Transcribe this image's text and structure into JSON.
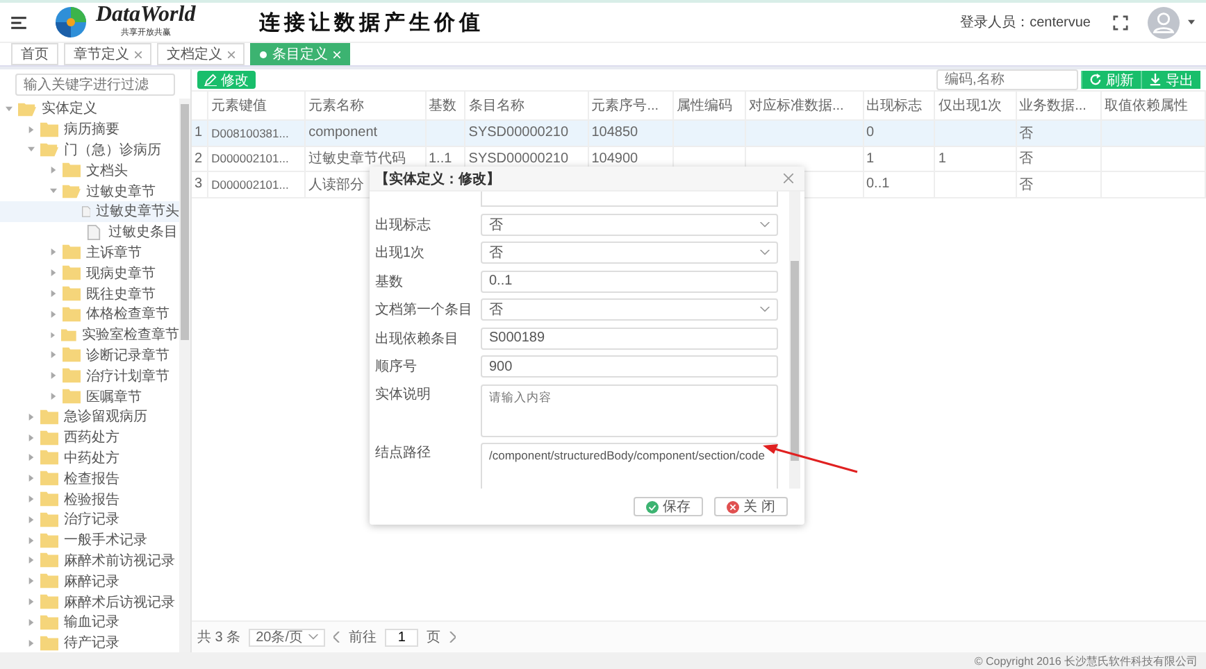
{
  "header": {
    "logo_name": "DataWorld",
    "logo_tagline": "共享开放共赢",
    "slogan": "连接让数据产生价值",
    "user": "登录人员：centervue"
  },
  "tabs": [
    {
      "label": "首页",
      "closable": false,
      "selected": false
    },
    {
      "label": "章节定义",
      "closable": true,
      "selected": false
    },
    {
      "label": "文档定义",
      "closable": true,
      "selected": false
    },
    {
      "label": "条目定义",
      "closable": true,
      "selected": true
    }
  ],
  "sidebar": {
    "filter_placeholder": "输入关键字进行过滤",
    "tree": [
      {
        "label": "实体定义",
        "kind": "folder",
        "expanded": true,
        "selected": false,
        "children": [
          {
            "label": "病历摘要",
            "kind": "folder",
            "expanded": false,
            "selected": false
          },
          {
            "label": "门（急）诊病历",
            "kind": "folder",
            "expanded": true,
            "selected": false,
            "children": [
              {
                "label": "文档头",
                "kind": "folder",
                "expanded": false,
                "selected": false
              },
              {
                "label": "过敏史章节",
                "kind": "folder",
                "expanded": true,
                "selected": false,
                "children": [
                  {
                    "label": "过敏史章节头",
                    "kind": "file",
                    "selected": true
                  },
                  {
                    "label": "过敏史条目",
                    "kind": "file",
                    "selected": false
                  }
                ]
              },
              {
                "label": "主诉章节",
                "kind": "folder",
                "expanded": false,
                "selected": false
              },
              {
                "label": "现病史章节",
                "kind": "folder",
                "expanded": false,
                "selected": false
              },
              {
                "label": "既往史章节",
                "kind": "folder",
                "expanded": false,
                "selected": false
              },
              {
                "label": "体格检查章节",
                "kind": "folder",
                "expanded": false,
                "selected": false
              },
              {
                "label": "实验室检查章节",
                "kind": "folder",
                "expanded": false,
                "selected": false
              },
              {
                "label": "诊断记录章节",
                "kind": "folder",
                "expanded": false,
                "selected": false
              },
              {
                "label": "治疗计划章节",
                "kind": "folder",
                "expanded": false,
                "selected": false
              },
              {
                "label": "医嘱章节",
                "kind": "folder",
                "expanded": false,
                "selected": false
              }
            ]
          },
          {
            "label": "急诊留观病历",
            "kind": "folder",
            "expanded": false,
            "selected": false
          },
          {
            "label": "西药处方",
            "kind": "folder",
            "expanded": false,
            "selected": false
          },
          {
            "label": "中药处方",
            "kind": "folder",
            "expanded": false,
            "selected": false
          },
          {
            "label": "检查报告",
            "kind": "folder",
            "expanded": false,
            "selected": false
          },
          {
            "label": "检验报告",
            "kind": "folder",
            "expanded": false,
            "selected": false
          },
          {
            "label": "治疗记录",
            "kind": "folder",
            "expanded": false,
            "selected": false
          },
          {
            "label": "一般手术记录",
            "kind": "folder",
            "expanded": false,
            "selected": false
          },
          {
            "label": "麻醉术前访视记录",
            "kind": "folder",
            "expanded": false,
            "selected": false
          },
          {
            "label": "麻醉记录",
            "kind": "folder",
            "expanded": false,
            "selected": false
          },
          {
            "label": "麻醉术后访视记录",
            "kind": "folder",
            "expanded": false,
            "selected": false
          },
          {
            "label": "输血记录",
            "kind": "folder",
            "expanded": false,
            "selected": false
          },
          {
            "label": "待产记录",
            "kind": "folder",
            "expanded": false,
            "selected": false
          }
        ]
      }
    ]
  },
  "toolbar": {
    "edit_button": "修改",
    "search_placeholder": "编码,名称",
    "refresh_button": "刷新",
    "export_button": "导出"
  },
  "table": {
    "columns": [
      "",
      "元素键值",
      "元素名称",
      "基数",
      "条目名称",
      "元素序号...",
      "属性编码",
      "对应标准数据...",
      "出现标志",
      "仅出现1次",
      "业务数据...",
      "取值依赖属性"
    ],
    "rows": [
      {
        "selected": true,
        "cells": [
          "1",
          "D008100381...",
          "component",
          "",
          "SYSD00000210",
          "104850",
          "",
          "",
          "0",
          "",
          "否",
          ""
        ]
      },
      {
        "selected": false,
        "cells": [
          "2",
          "D000002101...",
          "过敏史章节代码",
          "1..1",
          "SYSD00000210",
          "104900",
          "",
          "",
          "1",
          "1",
          "否",
          ""
        ]
      },
      {
        "selected": false,
        "cells": [
          "3",
          "D000002101...",
          "人读部分",
          "",
          "",
          "",
          "",
          "",
          "0..1",
          "",
          "否",
          ""
        ]
      }
    ]
  },
  "pager": {
    "total": "共 3 条",
    "page_size": "20条/页",
    "goto": "前往",
    "page": "1",
    "unit": "页"
  },
  "dialog": {
    "title": "【实体定义：修改】",
    "fields": [
      {
        "label": "出现标志",
        "kind": "select",
        "value": "否"
      },
      {
        "label": "出现1次",
        "kind": "select",
        "value": "否"
      },
      {
        "label": "基数",
        "kind": "input",
        "value": "0..1"
      },
      {
        "label": "文档第一个条目",
        "kind": "select",
        "value": "否"
      },
      {
        "label": "出现依赖条目",
        "kind": "input",
        "value": "S000189"
      },
      {
        "label": "顺序号",
        "kind": "input",
        "value": "900"
      },
      {
        "label": "实体说明",
        "kind": "textarea",
        "placeholder": "请输入内容"
      },
      {
        "label": "结点路径",
        "kind": "textarea",
        "value": "/component/structuredBody/component/section/code"
      }
    ],
    "buttons": [
      {
        "label": "保存",
        "kind": "save"
      },
      {
        "label": "关 闭",
        "kind": "close"
      }
    ]
  },
  "copyright": "© Copyright 2016 长沙慧氏软件科技有限公司"
}
